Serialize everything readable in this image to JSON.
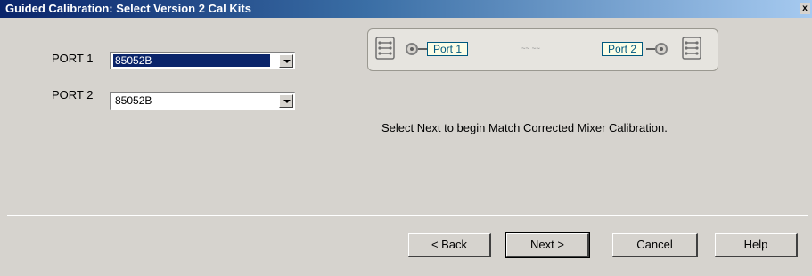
{
  "window": {
    "title": "Guided Calibration: Select Version 2 Cal Kits",
    "close_glyph": "x"
  },
  "ports": [
    {
      "label": "PORT 1",
      "kit_value": "85052B",
      "focused": true
    },
    {
      "label": "PORT 2",
      "kit_value": "85052B",
      "focused": false
    }
  ],
  "diagram": {
    "port1_label": "Port 1",
    "port2_label": "Port 2",
    "middle_marks": "~~   ~~"
  },
  "instruction": "Select Next to begin Match Corrected Mixer Calibration.",
  "buttons": {
    "back": "< Back",
    "next": "Next >",
    "cancel": "Cancel",
    "help": "Help"
  },
  "icons": {
    "connector_left": "connector-array-icon",
    "connector_right": "connector-array-icon",
    "dropdown_arrow": "chevron-down-icon"
  }
}
